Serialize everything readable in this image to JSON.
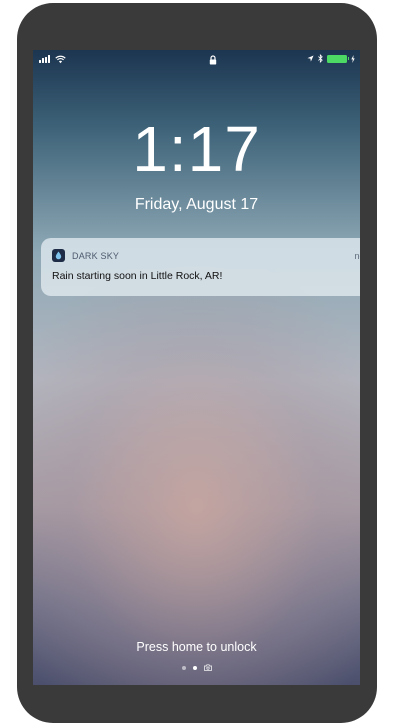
{
  "lock_screen": {
    "time": "1:17",
    "date": "Friday, August 17"
  },
  "notification": {
    "app_name": "DARK SKY",
    "time": "now",
    "message": "Rain starting soon in Little Rock, AR!",
    "app_icon": "raindrop-icon"
  },
  "footer": {
    "unlock_hint": "Press home to unlock",
    "pages": [
      "dot",
      "dot-active",
      "camera"
    ]
  },
  "status_bar": {
    "icons": [
      "signal-icon",
      "wifi-icon",
      "lock-icon",
      "location-icon",
      "bluetooth-icon",
      "battery-icon",
      "charging-icon"
    ]
  },
  "colors": {
    "battery": "#4cd964",
    "phone_frame": "#3a3a3a"
  }
}
